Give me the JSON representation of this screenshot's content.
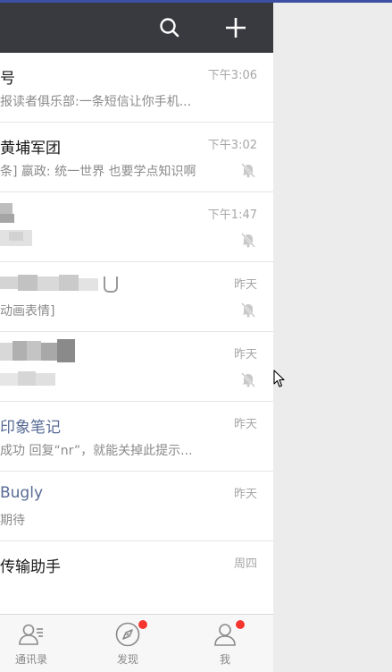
{
  "header": {
    "search_icon": "search-icon",
    "add_icon": "plus-icon",
    "background": "#393a3f"
  },
  "chats": [
    {
      "name": "号",
      "preview": "报读者俱乐部:一条短信让你手机...",
      "time": "下午3:06",
      "muted": false,
      "link": false
    },
    {
      "name": "黄埔军团",
      "preview": "条] 嬴政: 统一世界 也要学点知识啊",
      "time": "下午3:02",
      "muted": true,
      "link": false
    },
    {
      "name": "",
      "preview": "",
      "time": "下午1:47",
      "muted": true,
      "link": false
    },
    {
      "name": "",
      "preview": "动画表情]",
      "time": "昨天",
      "muted": true,
      "link": false
    },
    {
      "name": "",
      "preview": "",
      "time": "昨天",
      "muted": true,
      "link": false
    },
    {
      "name": "印象笔记",
      "preview": "成功  回复“nr”，就能关掉此提示...",
      "time": "昨天",
      "muted": false,
      "link": true
    },
    {
      "name": "Bugly",
      "preview": "期待",
      "time": "昨天",
      "muted": false,
      "link": true
    },
    {
      "name": "传输助手",
      "preview": "",
      "time": "周四",
      "muted": false,
      "link": false
    }
  ],
  "tabs": {
    "contacts": {
      "label": "通讯录",
      "icon": "contacts-icon",
      "badge": false
    },
    "discover": {
      "label": "发现",
      "icon": "compass-icon",
      "badge": true
    },
    "me": {
      "label": "我",
      "icon": "person-icon",
      "badge": true
    }
  },
  "colors": {
    "link_name": "#576b95",
    "badge": "#f43530",
    "muted_icon": "#c8c8c8"
  }
}
